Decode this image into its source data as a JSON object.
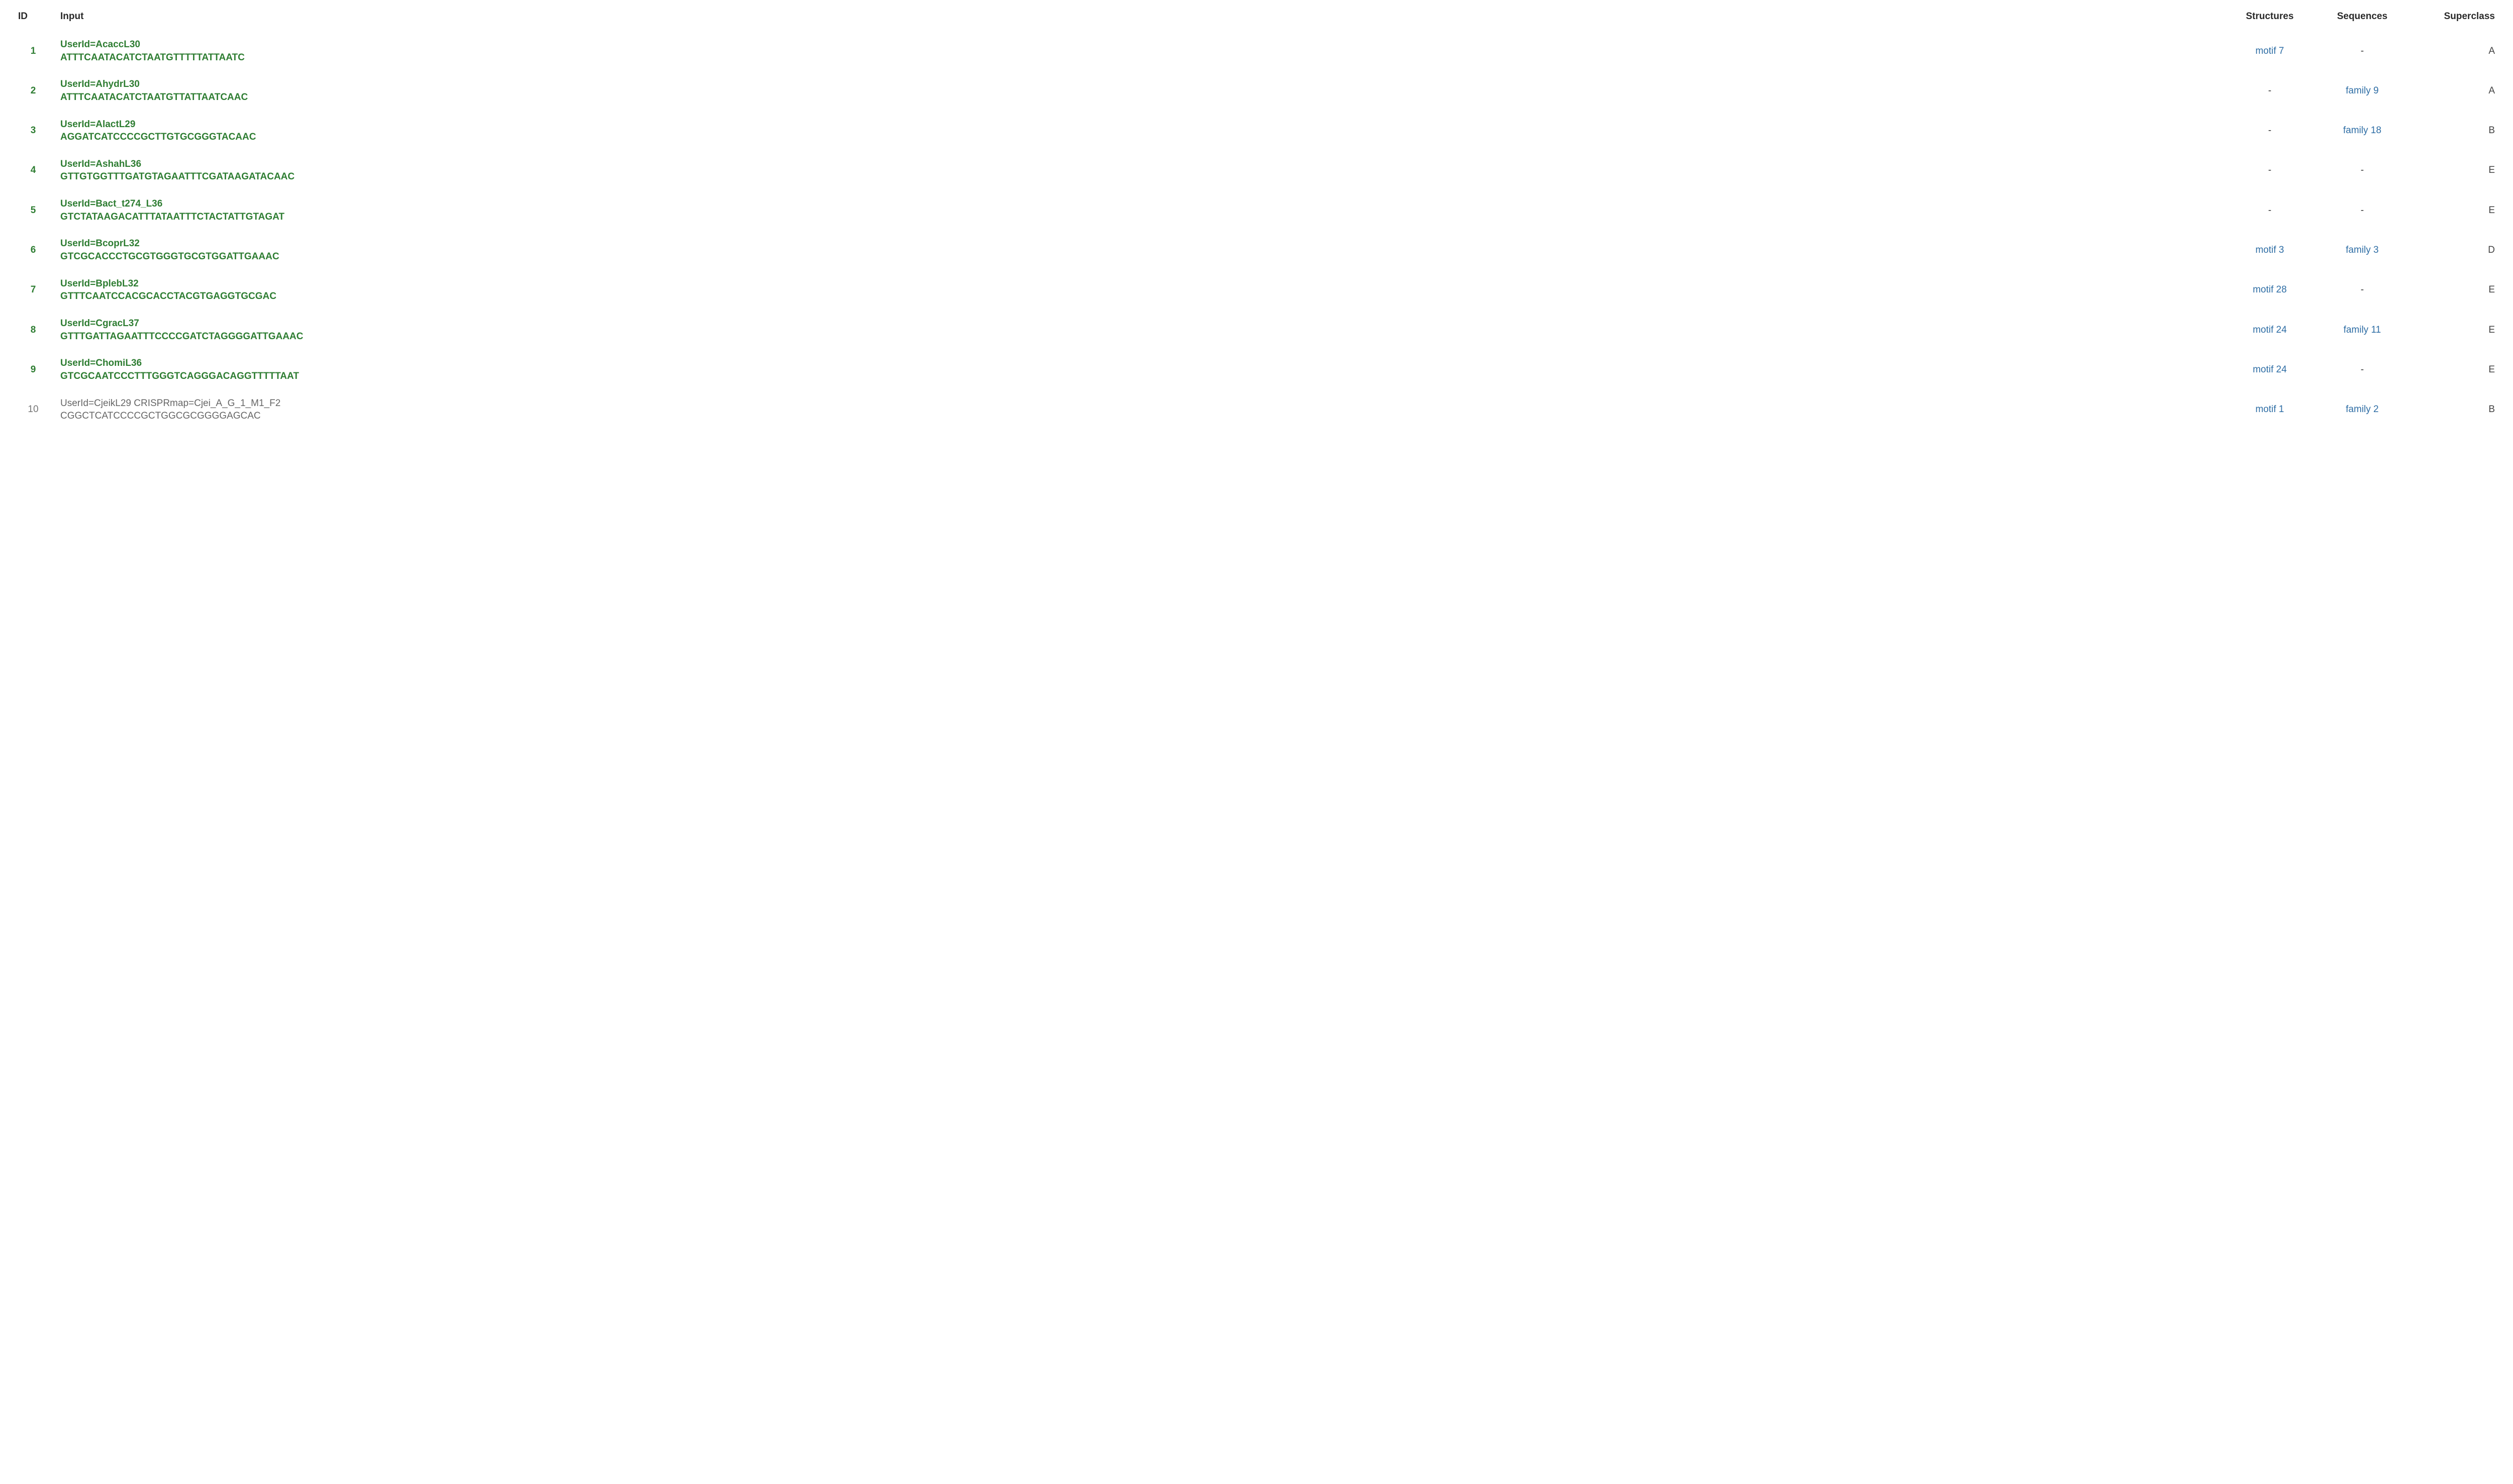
{
  "headers": {
    "id": "ID",
    "input": "Input",
    "structures": "Structures",
    "sequences": "Sequences",
    "superclass": "Superclass"
  },
  "rows": [
    {
      "id": "1",
      "novel": true,
      "input_line1": "UserId=AcaccL30",
      "input_line2": "ATTTCAATACATCTAATGTTTTTATTAATC",
      "structure": "motif 7",
      "structure_link": true,
      "sequence": "-",
      "sequence_link": false,
      "superclass": "A"
    },
    {
      "id": "2",
      "novel": true,
      "input_line1": "UserId=AhydrL30",
      "input_line2": "ATTTCAATACATCTAATGTTATTAATCAAC",
      "structure": "-",
      "structure_link": false,
      "sequence": "family 9",
      "sequence_link": true,
      "superclass": "A"
    },
    {
      "id": "3",
      "novel": true,
      "input_line1": "UserId=AlactL29",
      "input_line2": "AGGATCATCCCCGCTTGTGCGGGTACAAC",
      "structure": "-",
      "structure_link": false,
      "sequence": "family 18",
      "sequence_link": true,
      "superclass": "B"
    },
    {
      "id": "4",
      "novel": true,
      "input_line1": "UserId=AshahL36",
      "input_line2": "GTTGTGGTTTGATGTAGAATTTCGATAAGATACAAC",
      "structure": "-",
      "structure_link": false,
      "sequence": "-",
      "sequence_link": false,
      "superclass": "E"
    },
    {
      "id": "5",
      "novel": true,
      "input_line1": "UserId=Bact_t274_L36",
      "input_line2": "GTCTATAAGACATTTATAATTTCTACTATTGTAGAT",
      "structure": "-",
      "structure_link": false,
      "sequence": "-",
      "sequence_link": false,
      "superclass": "E"
    },
    {
      "id": "6",
      "novel": true,
      "input_line1": "UserId=BcoprL32",
      "input_line2": "GTCGCACCCTGCGTGGGTGCGTGGATTGAAAC",
      "structure": "motif 3",
      "structure_link": true,
      "sequence": "family 3",
      "sequence_link": true,
      "superclass": "D"
    },
    {
      "id": "7",
      "novel": true,
      "input_line1": "UserId=BplebL32",
      "input_line2": "GTTTCAATCCACGCACCTACGTGAGGTGCGAC",
      "structure": "motif 28",
      "structure_link": true,
      "sequence": "-",
      "sequence_link": false,
      "superclass": "E"
    },
    {
      "id": "8",
      "novel": true,
      "input_line1": "UserId=CgracL37",
      "input_line2": "GTTTGATTAGAATTTCCCCGATCTAGGGGATTGAAAC",
      "structure": "motif 24",
      "structure_link": true,
      "sequence": "family 11",
      "sequence_link": true,
      "superclass": "E"
    },
    {
      "id": "9",
      "novel": true,
      "input_line1": "UserId=ChomiL36",
      "input_line2": "GTCGCAATCCCTTTGGGTCAGGGACAGGTTTTTAAT",
      "structure": "motif 24",
      "structure_link": true,
      "sequence": "-",
      "sequence_link": false,
      "superclass": "E"
    },
    {
      "id": "10",
      "novel": false,
      "input_line1": "UserId=CjeikL29 CRISPRmap=Cjei_A_G_1_M1_F2",
      "input_line2": "CGGCTCATCCCCGCTGGCGCGGGGAGCAC",
      "structure": "motif 1",
      "structure_link": true,
      "sequence": "family 2",
      "sequence_link": true,
      "superclass": "B"
    }
  ]
}
